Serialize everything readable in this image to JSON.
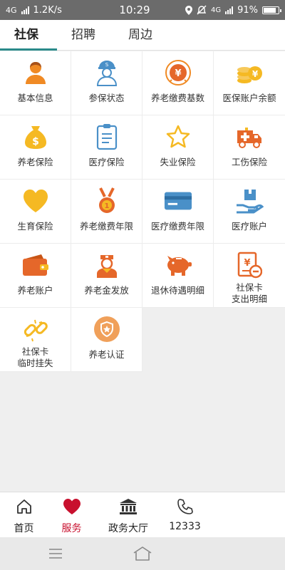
{
  "status_bar": {
    "network": "4G",
    "speed": "1.2K/s",
    "time": "10:29",
    "network_right": "4G",
    "battery": "91%"
  },
  "tabs": [
    {
      "label": "社保",
      "active": true
    },
    {
      "label": "招聘",
      "active": false
    },
    {
      "label": "周边",
      "active": false
    }
  ],
  "services": [
    {
      "label": "基本信息",
      "icon": "person-icon"
    },
    {
      "label": "参保状态",
      "icon": "worker-icon"
    },
    {
      "label": "养老缴费基数",
      "icon": "yen-coin-icon"
    },
    {
      "label": "医保账户余额",
      "icon": "coins-icon"
    },
    {
      "label": "养老保险",
      "icon": "money-bag-icon"
    },
    {
      "label": "医疗保险",
      "icon": "clipboard-icon"
    },
    {
      "label": "失业保险",
      "icon": "star-icon"
    },
    {
      "label": "工伤保险",
      "icon": "ambulance-icon"
    },
    {
      "label": "生育保险",
      "icon": "heart-icon"
    },
    {
      "label": "养老缴费年限",
      "icon": "medal-icon"
    },
    {
      "label": "医疗缴费年限",
      "icon": "bank-card-icon"
    },
    {
      "label": "医疗账户",
      "icon": "hand-box-icon"
    },
    {
      "label": "养老账户",
      "icon": "wallet-icon"
    },
    {
      "label": "养老金发放",
      "icon": "nurse-icon"
    },
    {
      "label": "退休待遇明细",
      "icon": "piggy-bank-icon"
    },
    {
      "label": "社保卡\n支出明细",
      "icon": "yen-doc-icon"
    },
    {
      "label": "社保卡\n临时挂失",
      "icon": "broken-link-icon"
    },
    {
      "label": "养老认证",
      "icon": "shield-badge-icon"
    }
  ],
  "bottom_nav": [
    {
      "label": "首页",
      "icon": "home-icon",
      "active": false
    },
    {
      "label": "服务",
      "icon": "heart-icon",
      "active": true
    },
    {
      "label": "政务大厅",
      "icon": "government-building-icon",
      "active": false
    },
    {
      "label": "12333",
      "icon": "phone-icon",
      "active": false
    }
  ],
  "colors": {
    "accent": "#2a8a8a",
    "active_nav": "#c8102e",
    "icon_orange": "#f08a24",
    "icon_blue": "#4a90c8",
    "icon_yellow": "#f5b923"
  }
}
